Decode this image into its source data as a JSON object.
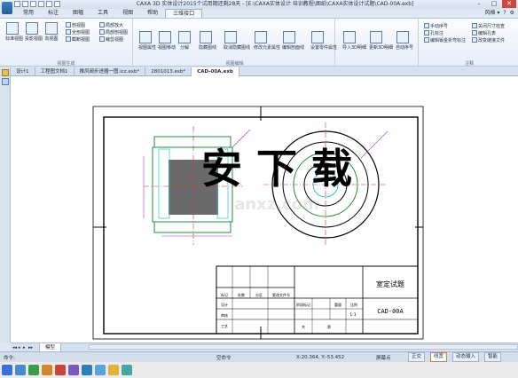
{
  "window": {
    "title": "CAXA 3D 实体设计2015个试用期还剩28天 - [E:\\CAXA实体设计 培训教程\\图纸\\CAXA实体设计试题\\CAD-00A.exb]",
    "controls": [
      "–",
      "□",
      "✕"
    ]
  },
  "menubar": {
    "tabs": [
      "常用",
      "标注",
      "图幅",
      "工具",
      "视图",
      "帮助",
      "三维接口"
    ],
    "active_tab": "三维接口",
    "right_items": [
      "风格 ▾",
      "?",
      "⚙"
    ]
  },
  "ribbon": {
    "groups": [
      {
        "label": "视图生成",
        "big_buttons": [
          "标准视图",
          "投影视图",
          "向视图"
        ],
        "small_buttons": [
          "剖视图",
          "全剖视图",
          "截断视图",
          "局部放大",
          "局部剖视图",
          "裁剪视图"
        ]
      },
      {
        "label": "视图编辑",
        "big_buttons": [
          "视图属性",
          "视图移动",
          "分解",
          "隐藏图线",
          "取消隐藏图线",
          "修改元素属性",
          "编辑剖面线",
          "设置零件属性"
        ]
      },
      {
        "label": "",
        "big_buttons": [
          "导入3D明细",
          "更新3D明细",
          "自动序号"
        ]
      },
      {
        "label": "注释",
        "small_buttons": [
          "手动序号",
          "孔标注",
          "编辑钣金折弯标注",
          "关闭尺寸检查",
          "编辑孔表",
          "改变链接文件"
        ]
      }
    ]
  },
  "doc_tabs": {
    "items": [
      "设计1",
      "工程图文档1",
      "推风阀步进器一图.icz.exb*",
      "2801013.exb*",
      "CAD-00A.exb"
    ],
    "active": "CAD-00A.exb"
  },
  "drawing": {
    "title_block": {
      "part_name": "室定试题",
      "drawing_number": "CAD-00A",
      "scale": "1:1",
      "cells": [
        "标记",
        "处数",
        "分区",
        "更改文件号",
        "签名",
        "年月日",
        "设计",
        "审核",
        "工艺",
        "批准",
        "阶段标记",
        "重量",
        "比例",
        "共",
        "张",
        "第",
        "张"
      ]
    },
    "watermark": "安 下 载\nanxz.com"
  },
  "bottom_tabs": {
    "nav": [
      "◂",
      "▸",
      "◂◂",
      "▸▸"
    ],
    "items": [
      "模型"
    ]
  },
  "statusbar": {
    "prompt": "命令:",
    "state": "空命令",
    "coords": "X:20.364, Y:-53.452",
    "snap_mode": "屏幕点",
    "toggles": [
      "正交",
      "线宽",
      "动态输入",
      "智能"
    ],
    "active_toggle": "线宽"
  },
  "colors": {
    "ribbon_bg": "#eaf1fa",
    "drawing_green": "#1f8f3a",
    "drawing_cyan": "#2ec4d3",
    "centerline_red": "#d63030",
    "dimension_purple": "#b638c9",
    "section_fill": "#6a6a6a"
  }
}
